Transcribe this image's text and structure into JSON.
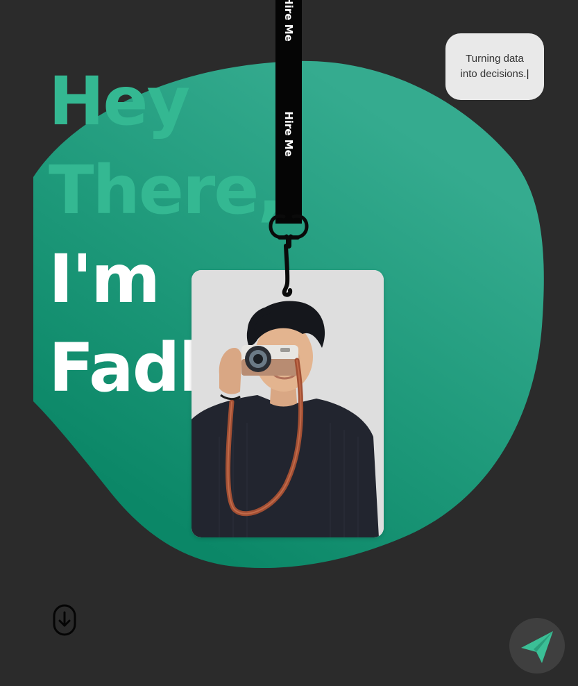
{
  "hero": {
    "greeting_line1": "Hey",
    "greeting_line2": "There,",
    "intro_line1": "I'm",
    "intro_line2": "Fadh"
  },
  "tagline": {
    "text": "Turning data into decisions.",
    "caret": "|"
  },
  "lanyard": {
    "strap_text_1": "Hire Me",
    "strap_text_2": "Hire Me"
  },
  "colors": {
    "background": "#2b2b2b",
    "blob_light": "#35b08f",
    "blob_dark": "#0e8a6c",
    "headline_accent": "#34b892",
    "headline_primary": "#ffffff",
    "send_icon": "#3bbf96"
  },
  "icons": {
    "scroll": "arrow-down-circle-icon",
    "send": "paper-plane-icon"
  }
}
